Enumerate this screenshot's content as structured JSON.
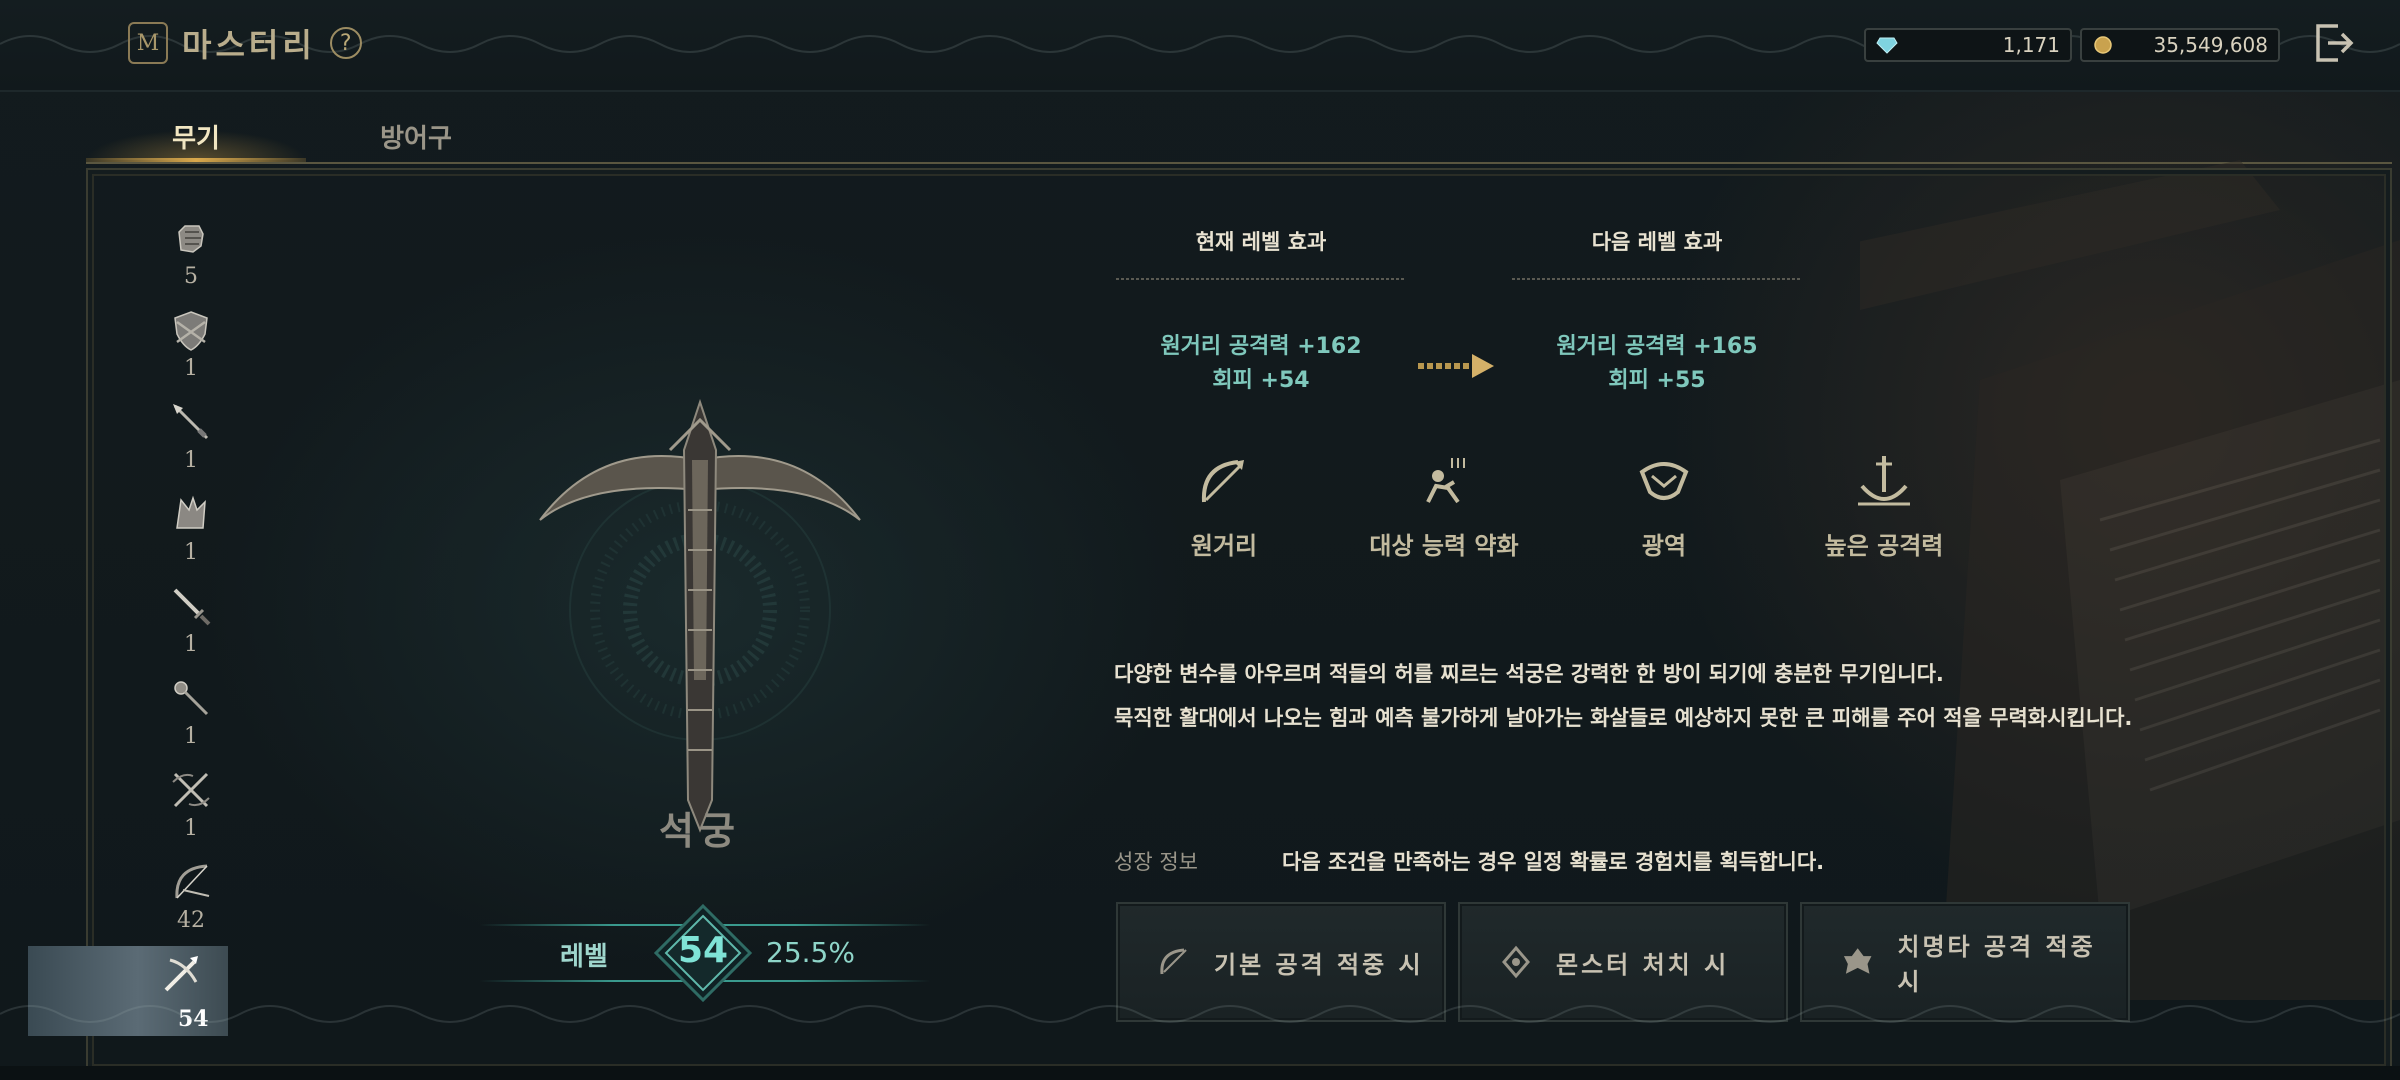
{
  "header": {
    "title": "마스터리",
    "badge_letter": "M",
    "help_symbol": "?",
    "currencies": [
      {
        "icon": "diamond-icon",
        "value": "1,171",
        "color": "#7fd3e0"
      },
      {
        "icon": "gold-coin-icon",
        "value": "35,549,608",
        "color": "#c9a24e"
      }
    ]
  },
  "tabs": [
    {
      "label": "무기",
      "active": true
    },
    {
      "label": "방어구",
      "active": false
    }
  ],
  "sidebar": {
    "items": [
      {
        "icon": "gauntlet-icon",
        "count": "5"
      },
      {
        "icon": "shield-icon",
        "count": "1"
      },
      {
        "icon": "spear-icon",
        "count": "1"
      },
      {
        "icon": "claw-icon",
        "count": "1"
      },
      {
        "icon": "sword-icon",
        "count": "1"
      },
      {
        "icon": "staff-icon",
        "count": "1"
      },
      {
        "icon": "dual-crossbow-icon",
        "count": "1"
      },
      {
        "icon": "bow-icon",
        "count": "42"
      },
      {
        "icon": "crossbow-icon",
        "count": "54",
        "selected": true
      }
    ]
  },
  "weapon": {
    "name": "석궁",
    "level_label": "레벨",
    "level": "54",
    "progress": "25.5%"
  },
  "effects": {
    "current_heading": "현재 레벨 효과",
    "next_heading": "다음 레벨 효과",
    "current": [
      "원거리 공격력 +162",
      "회피 +54"
    ],
    "next": [
      "원거리 공격력 +165",
      "회피 +55"
    ]
  },
  "traits": [
    {
      "icon": "ranged-icon",
      "label": "원거리"
    },
    {
      "icon": "debuff-icon",
      "label": "대상 능력 약화"
    },
    {
      "icon": "area-icon",
      "label": "광역"
    },
    {
      "icon": "high-attack-icon",
      "label": "높은 공격력"
    }
  ],
  "description": [
    "다양한 변수를 아우르며 적들의 허를 찌르는 석궁은 강력한 한 방이 되기에 충분한 무기입니다.",
    "묵직한 활대에서 나오는 힘과 예측 불가하게 날아가는 화살들로 예상하지 못한 큰 피해를 주어 적을 무력화시킵니다."
  ],
  "growth": {
    "label": "성장 정보",
    "text": "다음 조건을 만족하는 경우 일정 확률로 경험치를 획득합니다.",
    "conditions": [
      {
        "icon": "basic-attack-icon",
        "label": "기본 공격 적중 시"
      },
      {
        "icon": "monster-kill-icon",
        "label": "몬스터 처치 시"
      },
      {
        "icon": "critical-hit-icon",
        "label": "치명타 공격 적중 시"
      }
    ]
  },
  "colors": {
    "accent_gold": "#d9a84c",
    "teal": "#7fc8bc",
    "panel_bg": "#10181b"
  }
}
